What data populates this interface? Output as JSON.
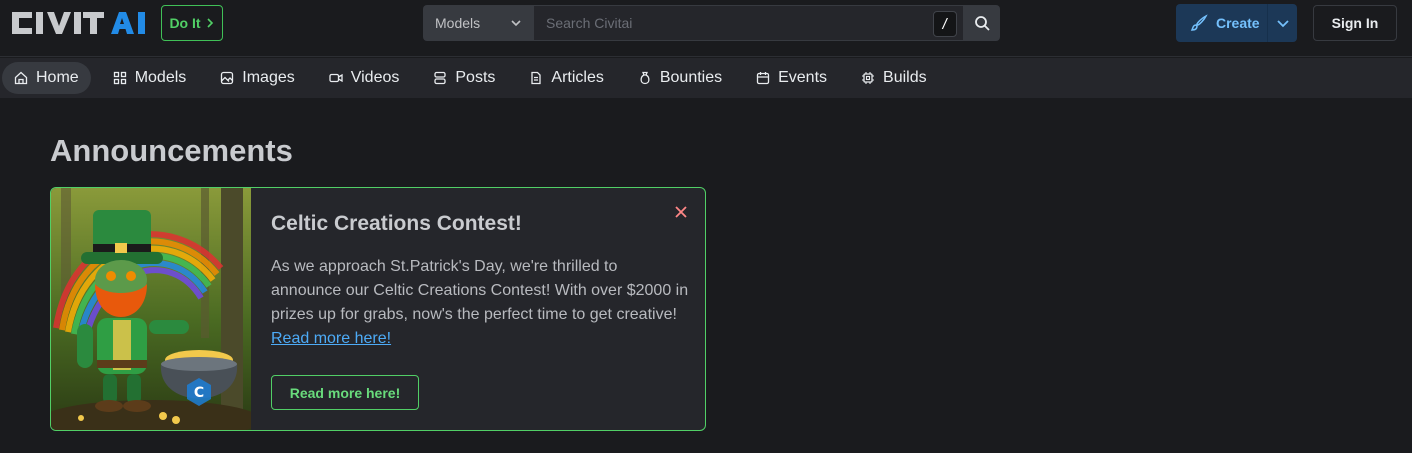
{
  "header": {
    "logo_text": "CIVITAI",
    "do_it_label": "Do It",
    "search": {
      "scope_selected": "Models",
      "placeholder": "Search Civitai",
      "shortcut": "/"
    },
    "create_label": "Create",
    "sign_in_label": "Sign In"
  },
  "nav": {
    "items": [
      {
        "label": "Home",
        "icon": "home-icon",
        "active": true
      },
      {
        "label": "Models",
        "icon": "grid-icon"
      },
      {
        "label": "Images",
        "icon": "image-icon"
      },
      {
        "label": "Videos",
        "icon": "video-icon"
      },
      {
        "label": "Posts",
        "icon": "posts-icon"
      },
      {
        "label": "Articles",
        "icon": "article-icon"
      },
      {
        "label": "Bounties",
        "icon": "moneybag-icon"
      },
      {
        "label": "Events",
        "icon": "calendar-icon"
      },
      {
        "label": "Builds",
        "icon": "cpu-icon"
      }
    ]
  },
  "announcements": {
    "heading": "Announcements",
    "card": {
      "title": "Celtic Creations Contest!",
      "body": "As we approach St.Patrick's Day, we're thrilled to announce our Celtic Creations Contest! With over $2000 in prizes up for grabs, now's the perfect time to get creative! ",
      "inline_link": "Read more here!",
      "button_label": "Read more here!",
      "image_alt": "Leprechaun robot with pot of gold"
    }
  },
  "colors": {
    "accent_green": "#51cf66",
    "link_blue": "#4dabf7",
    "create_bg": "#1c3857",
    "logo_blue": "#228be6"
  }
}
